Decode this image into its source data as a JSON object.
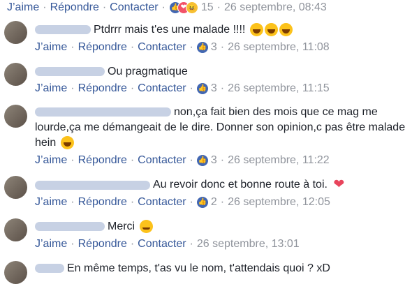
{
  "labels": {
    "like": "J’aime",
    "reply": "Répondre",
    "contact": "Contacter",
    "sep": "·"
  },
  "colors": {
    "link": "#365899",
    "meta": "#90949c",
    "like_badge": "#4267b2"
  },
  "top_actions": {
    "count": "15",
    "time": "26 septembre, 08:43",
    "reactions": [
      "like-icon",
      "love-icon",
      "haha-icon"
    ]
  },
  "comments": [
    {
      "text": "Ptdrrr mais t'es une malade !!!! ",
      "emoji": [
        "laugh-cry",
        "laugh-cry",
        "laugh-cry"
      ],
      "likes": "3",
      "time": "26 septembre, 11:08"
    },
    {
      "text": "Ou pragmatique",
      "emoji": [],
      "likes": "3",
      "time": "26 septembre, 11:15"
    },
    {
      "text": "non,ça fait bien des mois que ce mag me lourde,ça me démangeait de le dire. Donner son opinion,c pas être malade hein ",
      "emoji": [
        "laugh-cry"
      ],
      "likes": "3",
      "time": "26 septembre, 11:22"
    },
    {
      "text": "Au revoir donc et bonne route à toi. ",
      "emoji": [
        "heart"
      ],
      "likes": "2",
      "time": "26 septembre, 12:05"
    },
    {
      "text": "Merci ",
      "emoji": [
        "smile"
      ],
      "likes": "",
      "time": "26 septembre, 13:01"
    },
    {
      "text": "En même temps, t'as vu le nom, t'attendais quoi ? xD",
      "emoji": []
    }
  ]
}
